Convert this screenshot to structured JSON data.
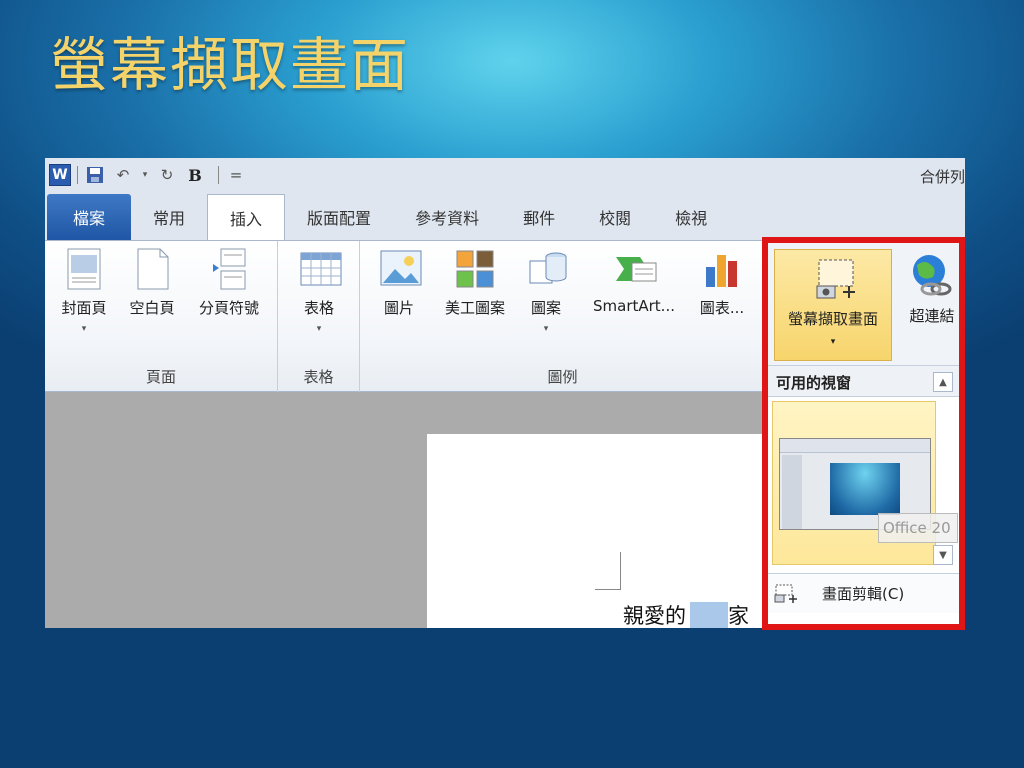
{
  "slide": {
    "title": "螢幕擷取畫面"
  },
  "qat": {
    "app_logo": "W",
    "bold": "B",
    "more": "=",
    "merge": "合併列"
  },
  "tabs": [
    "檔案",
    "常用",
    "插入",
    "版面配置",
    "參考資料",
    "郵件",
    "校閱",
    "檢視"
  ],
  "ribbon": {
    "groups": {
      "pages": "頁面",
      "tables": "表格",
      "illustrations": "圖例"
    },
    "buttons": {
      "cover_page": "封面頁",
      "blank_page": "空白頁",
      "page_break": "分頁符號",
      "table": "表格",
      "picture": "圖片",
      "clip_art": "美工圖案",
      "shapes": "圖案",
      "smartart": "SmartArt...",
      "chart": "圖表...",
      "screenshot": "螢幕擷取畫面",
      "hyperlink": "超連結"
    },
    "arrow": "▾"
  },
  "document": {
    "text": "親愛的",
    "text2": "家"
  },
  "dropdown": {
    "header": "可用的視窗",
    "tooltip": "Office 20",
    "clip_label": "畫面剪輯(C)",
    "scroll_up": "▲",
    "scroll_down": "▼"
  }
}
